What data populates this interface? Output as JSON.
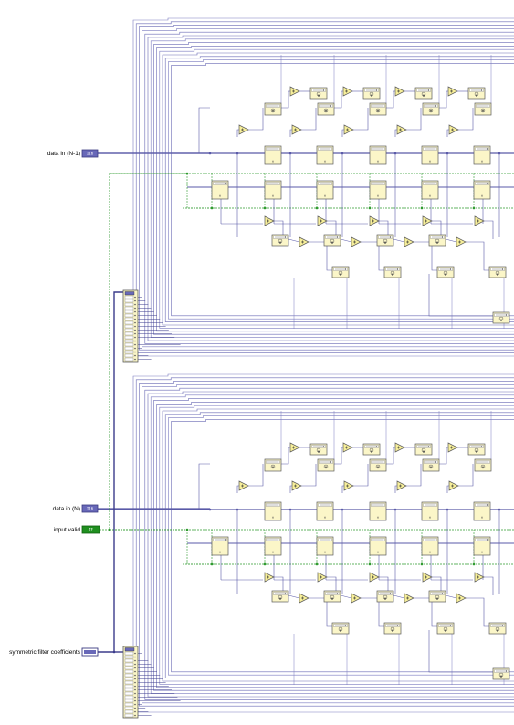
{
  "terminals": {
    "data_in_n1": {
      "label": "data in (N-1)",
      "badge": "I16",
      "type": "numeric"
    },
    "data_in_n": {
      "label": "data in (N)",
      "badge": "I16",
      "type": "numeric"
    },
    "input_valid": {
      "label": "input valid",
      "badge": "TF",
      "type": "boolean"
    },
    "coefficients": {
      "label": "symmetric filter coefficients",
      "badge": "[I16]",
      "type": "numeric"
    }
  },
  "colors": {
    "numeric_wire": "#5a5aa8",
    "numeric_terminal_fill": "#6868b8",
    "boolean_wire": "#2e9a2e",
    "boolean_terminal_fill": "#1f8f1f",
    "array_wire": "#3c3c8c",
    "block_border": "#5b5b5b",
    "block_fill": "#fbf6c8",
    "adder_fill": "#f7ef9a"
  },
  "blocks": {
    "index_array": "index-array-node",
    "adder": "add-node",
    "delay": "feedback-node",
    "multiply": "multiply-accumulate-node"
  }
}
